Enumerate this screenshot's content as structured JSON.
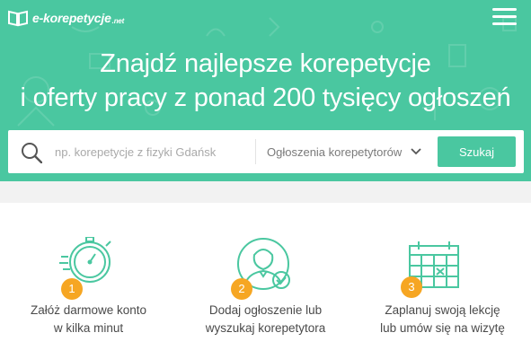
{
  "header": {
    "logo_text": "e-korepetycje",
    "logo_suffix": ".net",
    "menu_icon": "hamburger-menu-icon"
  },
  "hero": {
    "headline_line1": "Znajdź najlepsze korepetycje",
    "headline_line2": "i oferty pracy z ponad 200 tysięcy ogłoszeń"
  },
  "search": {
    "placeholder": "np. korepetycje z fizyki Gdańsk",
    "value": "",
    "category_selected": "Ogłoszenia korepetytorów",
    "button_label": "Szukaj"
  },
  "steps": [
    {
      "number": "1",
      "icon": "stopwatch-icon",
      "line1": "Załóż darmowe konto",
      "line2": "w kilka minut"
    },
    {
      "number": "2",
      "icon": "tutor-check-icon",
      "line1": "Dodaj ogłoszenie lub",
      "line2": "wyszukaj korepetytora"
    },
    {
      "number": "3",
      "icon": "calendar-icon",
      "line1": "Zaplanuj swoją lekcję",
      "line2": "lub umów się na wizytę"
    }
  ],
  "colors": {
    "brand_green": "#4ac7a0",
    "badge_orange": "#f6a623",
    "text_dark": "#4a4a4a"
  }
}
